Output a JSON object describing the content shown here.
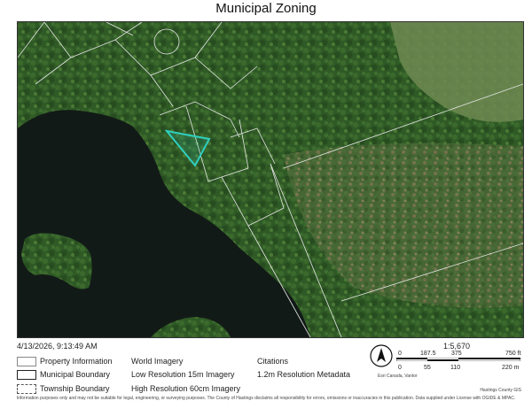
{
  "map": {
    "title": "Municipal Zoning",
    "timestamp": "4/13/2026, 9:13:49 AM"
  },
  "legend": {
    "property_information": "Property Information",
    "municipal_boundary": "Municipal Boundary",
    "township_boundary": "Township Boundary",
    "world_imagery": "World Imagery",
    "low_res": "Low Resolution 15m Imagery",
    "high_res": "High Resolution 60cm Imagery",
    "citations": "Citations",
    "metadata": "1.2m Resolution Metadata"
  },
  "scale": {
    "ratio": "1:5,670",
    "ft_ticks": [
      "0",
      "187.5",
      "375",
      "750 ft"
    ],
    "m_ticks": [
      "0",
      "55",
      "110",
      "220 m"
    ]
  },
  "credits": {
    "source": "Esri Canada, Vantor",
    "county": "Hastings County GIS",
    "disclaimer": "Information purposes only and may not be suitable for legal, engineering, or surveying purposes.  The County of Hastings disclaims all responsibility for errors, omissions or inaccuracies in this publication. Data supplied under License with OGIDE & MPAC."
  },
  "colors": {
    "water": "#121a17",
    "forest": "#2f5a26",
    "selected_parcel": "#2fd0c0",
    "parcel_line": "#d8d8d8"
  }
}
